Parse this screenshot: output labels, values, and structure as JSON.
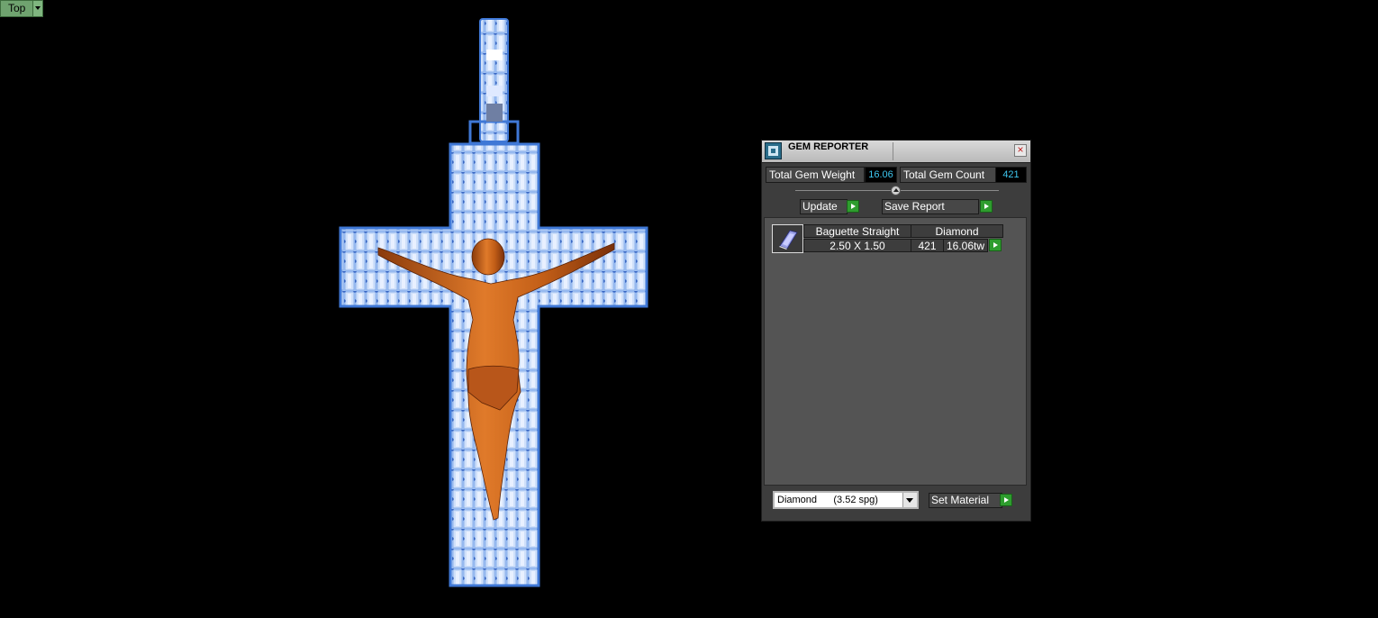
{
  "viewport": {
    "label": "Top"
  },
  "model": {
    "description_name": "crucifix pendant with baguette diamonds"
  },
  "panel": {
    "title": "GEM REPORTER",
    "total_gem_weight_label": "Total Gem Weight",
    "total_gem_weight_value": "16.06",
    "total_gem_count_label": "Total Gem Count",
    "total_gem_count_value": "421",
    "update_label": "Update",
    "save_report_label": "Save Report",
    "gems": [
      {
        "shape": "Baguette Straight",
        "material": "Diamond",
        "size": "2.50 X 1.50",
        "count": "421",
        "weight": "16.06tw"
      }
    ],
    "material_select": "Diamond      (3.52 spg)",
    "set_material_label": "Set Material"
  },
  "colors": {
    "gem_blue": "#8fb6f0",
    "metal_orange": "#d0681e",
    "panel_bg": "#3d3d3d",
    "value_cyan": "#3ec7f0",
    "go_green": "#2e9d2e"
  }
}
